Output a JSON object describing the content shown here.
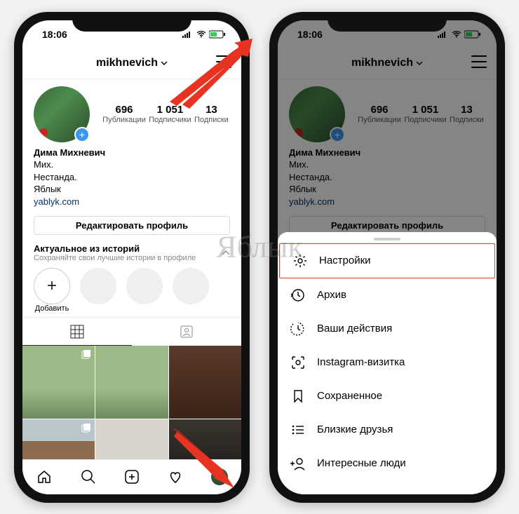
{
  "statusbar": {
    "time": "18:06"
  },
  "header": {
    "username": "mikhnevich"
  },
  "stats": {
    "posts": {
      "num": "696",
      "label": "Публикации"
    },
    "followers": {
      "num": "1 051",
      "label": "Подписчики"
    },
    "following": {
      "num": "13",
      "label": "Подписки"
    }
  },
  "bio": {
    "name": "Дима Михневич",
    "line1": "Мих.",
    "line2": "Нестанда.",
    "line3": "Яблык",
    "link": "yablyk.com"
  },
  "edit_profile": "Редактировать профиль",
  "highlights": {
    "title": "Актуальное из историй",
    "subtitle": "Сохраняйте свои лучшие истории в профиле",
    "add_label": "Добавить"
  },
  "menu": {
    "settings": "Настройки",
    "archive": "Архив",
    "activity": "Ваши действия",
    "nametag": "Instagram-визитка",
    "saved": "Сохраненное",
    "close": "Близкие друзья",
    "discover": "Интересные люди"
  },
  "watermark": "Яблык"
}
